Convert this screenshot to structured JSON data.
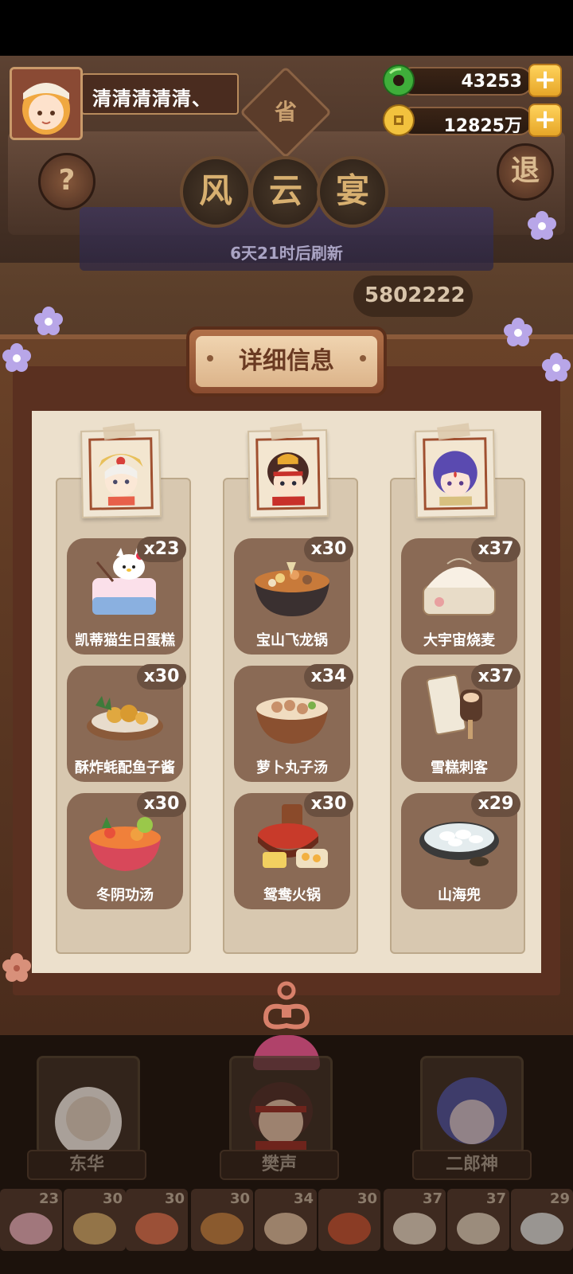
{
  "player": {
    "name": "清清清清清、"
  },
  "currencies": [
    {
      "name": "jade",
      "value": "43253",
      "color": "#3fae3a"
    },
    {
      "name": "coin",
      "value": "12825万",
      "color": "#e6b83a"
    }
  ],
  "header": {
    "province_label": "省",
    "title_chars": [
      "风",
      "云",
      "宴"
    ],
    "refresh_text": "6天21时后刷新",
    "score": "5802222",
    "help_label": "?",
    "exit_label": "退"
  },
  "detail": {
    "title": "详细信息",
    "columns": [
      {
        "dishes": [
          {
            "name": "凯蒂猫生日蛋糕",
            "count": "x23",
            "icon": "cake-icon",
            "color": "#f3b6c8"
          },
          {
            "name": "酥炸蚝配鱼子酱",
            "count": "x30",
            "icon": "oyster-icon",
            "color": "#d8b06a"
          },
          {
            "name": "冬阴功汤",
            "count": "x30",
            "icon": "soup-icon",
            "color": "#e8704a"
          }
        ]
      },
      {
        "dishes": [
          {
            "name": "宝山飞龙锅",
            "count": "x30",
            "icon": "hotpot-icon",
            "color": "#c9813a"
          },
          {
            "name": "萝卜丸子汤",
            "count": "x34",
            "icon": "meatball-soup-icon",
            "color": "#e8c8a8"
          },
          {
            "name": "鸳鸯火锅",
            "count": "x30",
            "icon": "yuanyang-hotpot-icon",
            "color": "#c84a2a"
          }
        ]
      },
      {
        "dishes": [
          {
            "name": "大宇宙烧麦",
            "count": "x37",
            "icon": "shaomai-icon",
            "color": "#f0e6d4"
          },
          {
            "name": "雪糕刺客",
            "count": "x37",
            "icon": "ice-cream-icon",
            "color": "#e8dcc8"
          },
          {
            "name": "山海兜",
            "count": "x29",
            "icon": "dumpling-icon",
            "color": "#e4ecee"
          }
        ]
      }
    ]
  },
  "heroes": [
    {
      "name": "东华",
      "color": "#d8d0c8"
    },
    {
      "name": "樊声",
      "color": "#b04a30"
    },
    {
      "name": "二郎神",
      "color": "#6a6ab8"
    }
  ],
  "tray": [
    "23",
    "30",
    "30",
    "30",
    "34",
    "30",
    "37",
    "37",
    "29"
  ]
}
